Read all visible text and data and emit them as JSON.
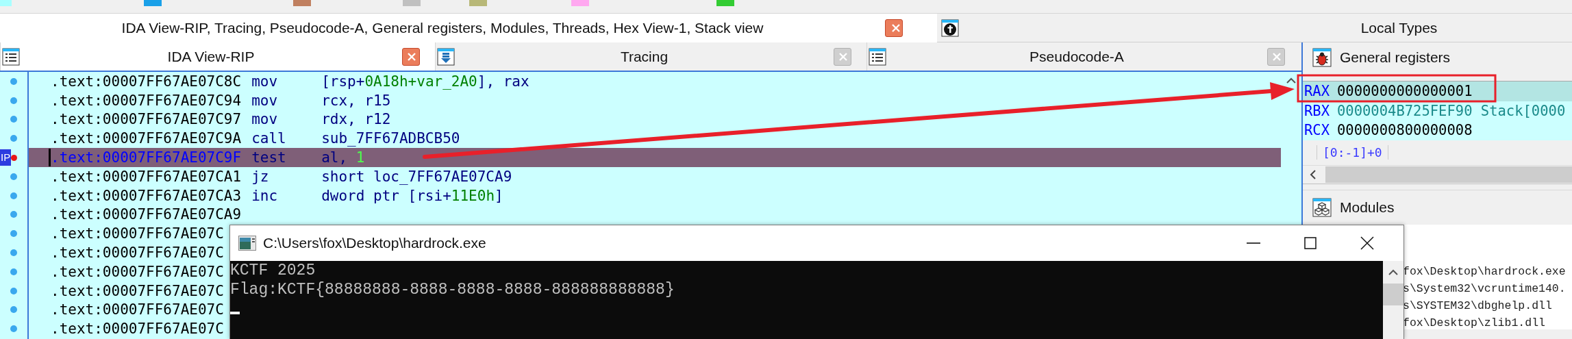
{
  "legend": [
    {
      "color": "#a8ffff"
    },
    {
      "color": "#1aa0e8"
    },
    {
      "color": "#c08060"
    },
    {
      "color": "#c0c0c0"
    },
    {
      "color": "#b8b878"
    },
    {
      "color": "#ffa8f0"
    },
    {
      "color": "#33cc33"
    }
  ],
  "outer_tabs": [
    {
      "label": "IDA View-RIP, Tracing, Pseudocode-A, General registers, Modules, Threads, Hex View-1, Stack view",
      "selected": true,
      "closable": true
    },
    {
      "label": "Local Types",
      "selected": false,
      "closable": false
    }
  ],
  "inner_tabs": [
    {
      "label": "IDA View-RIP",
      "selected": true
    },
    {
      "label": "Tracing",
      "selected": false
    },
    {
      "label": "Pseudocode-A",
      "selected": false
    }
  ],
  "disassembly": {
    "rows": [
      {
        "address": ".text:00007FF67AE07C8C",
        "mnemonic": "mov",
        "operands": [
          {
            "text": "[rsp+",
            "kind": "plain"
          },
          {
            "text": "0A18h+var_2A0",
            "kind": "number"
          },
          {
            "text": "], rax",
            "kind": "plain"
          }
        ],
        "selected": false
      },
      {
        "address": ".text:00007FF67AE07C94",
        "mnemonic": "mov",
        "operands": [
          {
            "text": "rcx, r15",
            "kind": "plain"
          }
        ],
        "selected": false
      },
      {
        "address": ".text:00007FF67AE07C97",
        "mnemonic": "mov",
        "operands": [
          {
            "text": "rdx, r12",
            "kind": "plain"
          }
        ],
        "selected": false
      },
      {
        "address": ".text:00007FF67AE07C9A",
        "mnemonic": "call",
        "operands": [
          {
            "text": "sub_7FF67ADBCB50",
            "kind": "plain"
          }
        ],
        "selected": false
      },
      {
        "address": ".text:00007FF67AE07C9F",
        "mnemonic": "test",
        "operands": [
          {
            "text": "al, ",
            "kind": "plain"
          },
          {
            "text": "1",
            "kind": "number"
          }
        ],
        "selected": true,
        "marker": "IP"
      },
      {
        "address": ".text:00007FF67AE07CA1",
        "mnemonic": "jz",
        "operands": [
          {
            "text": "short loc_7FF67AE07CA9",
            "kind": "plain"
          }
        ],
        "selected": false
      },
      {
        "address": ".text:00007FF67AE07CA3",
        "mnemonic": "inc",
        "operands": [
          {
            "text": "dword ptr [rsi+",
            "kind": "plain"
          },
          {
            "text": "11E0h",
            "kind": "number"
          },
          {
            "text": "]",
            "kind": "plain"
          }
        ],
        "selected": false
      },
      {
        "address": ".text:00007FF67AE07CA9",
        "selected": false
      },
      {
        "address": ".text:00007FF67AE07C",
        "selected": false
      },
      {
        "address": ".text:00007FF67AE07C",
        "selected": false
      },
      {
        "address": ".text:00007FF67AE07C",
        "selected": false
      },
      {
        "address": ".text:00007FF67AE07C",
        "selected": false
      },
      {
        "address": ".text:00007FF67AE07C",
        "selected": false
      },
      {
        "address": ".text:00007FF67AE07C",
        "selected": false
      }
    ]
  },
  "registers_panel": {
    "title": "General registers",
    "registers": [
      {
        "name": "RAX",
        "value": "0000000000000001",
        "kind": "plain",
        "selected": true
      },
      {
        "name": "RBX",
        "value": "0000004B725FEF90 Stack[0000",
        "kind": "pointer",
        "selected": false
      },
      {
        "name": "RCX",
        "value": "0000000800000008",
        "kind": "plain",
        "selected": false
      }
    ],
    "tabs": [
      {
        "label": "[0:-1]+0"
      }
    ]
  },
  "modules_panel": {
    "title": "Modules",
    "rows": [
      "fox\\Desktop\\hardrock.exe",
      "s\\System32\\vcruntime140.",
      "s\\SYSTEM32\\dbghelp.dll",
      "fox\\Desktop\\zlib1.dll"
    ]
  },
  "console": {
    "title": "C:\\Users\\fox\\Desktop\\hardrock.exe",
    "lines": [
      "KCTF 2025",
      "Flag:KCTF{88888888-8888-8888-8888-888888888888}"
    ]
  }
}
